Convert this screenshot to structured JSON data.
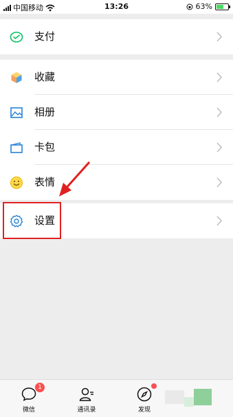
{
  "status_bar": {
    "carrier": "中国移动",
    "time": "13:26",
    "battery": "63%",
    "battery_level": 0.63
  },
  "menu": {
    "group1": [
      {
        "label": "支付",
        "icon": "wallet-icon",
        "color": "#07c160"
      }
    ],
    "group2": [
      {
        "label": "收藏",
        "icon": "favorites-cube-icon",
        "color": "#f5a623"
      },
      {
        "label": "相册",
        "icon": "album-icon",
        "color": "#2782d7"
      },
      {
        "label": "卡包",
        "icon": "card-wallet-icon",
        "color": "#2782d7"
      },
      {
        "label": "表情",
        "icon": "smiley-icon",
        "color": "#f7c23c"
      }
    ],
    "group3": [
      {
        "label": "设置",
        "icon": "settings-gear-icon",
        "color": "#2782d7"
      }
    ]
  },
  "tabbar": {
    "tabs": [
      {
        "label": "微信",
        "badge": "1",
        "icon": "chat-bubble-icon"
      },
      {
        "label": "通讯录",
        "icon": "contacts-icon"
      },
      {
        "label": "发现",
        "icon": "compass-icon"
      }
    ]
  },
  "colors": {
    "highlight": "#e02020",
    "badge": "#fa5151",
    "background": "#ededed"
  }
}
